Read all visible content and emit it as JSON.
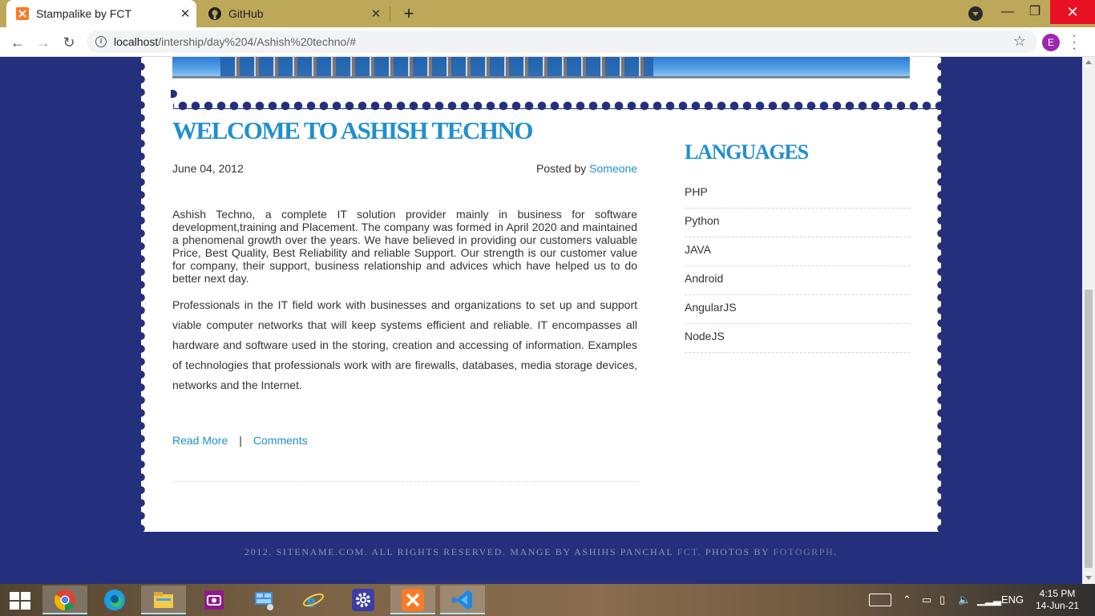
{
  "browser": {
    "tabs": [
      {
        "title": "Stampalike by FCT",
        "active": true,
        "favicon": "xampp-icon"
      },
      {
        "title": "GitHub",
        "active": false,
        "favicon": "github-icon"
      }
    ],
    "close_glyph": "✕",
    "new_tab_glyph": "+",
    "window": {
      "minimize": "—",
      "maximize": "❐",
      "close": "✕"
    },
    "nav": {
      "back": "←",
      "forward": "→",
      "reload": "↻"
    },
    "url_host": "localhost",
    "url_path": "/intership/day%204/Ashish%20techno/#",
    "profile_initial": "E",
    "info_glyph": "i",
    "star_glyph": "☆"
  },
  "post": {
    "title": "WELCOME TO ASHISH TECHNO",
    "date": "June 04, 2012",
    "posted_by_label": "Posted by",
    "author": "Someone",
    "paragraphs": [
      "Ashish Techno, a complete IT solution provider mainly in business for software development,training and Placement. The company was formed in April 2020 and maintained a phenomenal growth over the years. We have believed in providing our customers valuable Price, Best Quality, Best Reliability and reliable Support. Our strength is our customer value for company, their support, business relationship and advices which have helped us to do better next day.",
      "Professionals in the IT field work with businesses and organizations to set up and support viable computer networks that will keep systems efficient and reliable. IT encompasses all hardware and software used in the storing, creation and accessing of information. Examples of technologies that professionals work with are firewalls, databases, media storage devices, networks and the Internet."
    ],
    "read_more": "Read More",
    "separator": "|",
    "comments": "Comments"
  },
  "sidebar": {
    "title": "LANGUAGES",
    "items": [
      "PHP",
      "Python",
      "JAVA",
      "Android",
      "AngularJS",
      "NodeJS"
    ]
  },
  "footer": {
    "text_before": "2012. SITENAME.COM. ALL RIGHTS RESERVED. MANGE BY ASHIHS PANCHAL ",
    "fct": "FCT",
    "text_mid": ". PHOTOS BY ",
    "fotogrph": "FOTOGRPH",
    "text_end": "."
  },
  "taskbar": {
    "apps": [
      "windows-start-icon",
      "chrome-icon",
      "edge-icon",
      "file-explorer-icon",
      "camera-icon",
      "control-panel-icon",
      "internet-explorer-icon",
      "settings-icon",
      "xampp-icon",
      "vscode-icon"
    ],
    "language": "ENG",
    "time": "4:15 PM",
    "date": "14-Jun-21"
  },
  "colors": {
    "page_bg": "#25307c",
    "accent": "#1f8fcf",
    "tabstrip": "#bda85a",
    "close_red": "#e81123"
  }
}
